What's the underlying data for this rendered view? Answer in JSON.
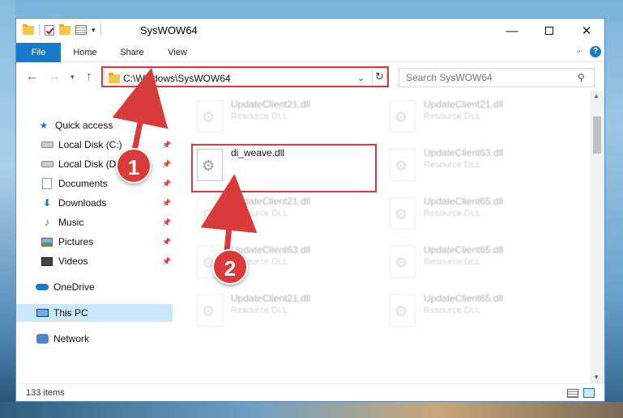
{
  "window": {
    "title": "SysWOW64",
    "controls": {
      "minimize": "—",
      "maximize": "",
      "close": "✕"
    }
  },
  "ribbon": {
    "tabs": [
      "File",
      "Home",
      "Share",
      "View"
    ],
    "collapse_glyph": "⌄",
    "help_glyph": "?"
  },
  "nav": {
    "back": "←",
    "forward": "→",
    "recent": "▾",
    "up": "↑"
  },
  "address": {
    "path": "C:\\Windows\\SysWOW64",
    "dropdown": "⌄",
    "refresh": "↻"
  },
  "search": {
    "placeholder": "Search SysWOW64",
    "icon": "⚲"
  },
  "sidebar": {
    "items": [
      {
        "label": "Quick access",
        "icon": "star-icon",
        "pinned": false
      },
      {
        "label": "Local Disk (C:)",
        "icon": "drive-icon",
        "pinned": true
      },
      {
        "label": "Local Disk (D:)",
        "icon": "drive-icon",
        "pinned": true
      },
      {
        "label": "Documents",
        "icon": "documents-icon",
        "pinned": true
      },
      {
        "label": "Downloads",
        "icon": "download-icon",
        "pinned": true
      },
      {
        "label": "Music",
        "icon": "music-icon",
        "pinned": true
      },
      {
        "label": "Pictures",
        "icon": "pictures-icon",
        "pinned": true
      },
      {
        "label": "Videos",
        "icon": "videos-icon",
        "pinned": true
      },
      {
        "label": "OneDrive",
        "icon": "cloud-icon",
        "pinned": false
      },
      {
        "label": "This PC",
        "icon": "computer-icon",
        "pinned": false,
        "selected": true
      },
      {
        "label": "Network",
        "icon": "network-icon",
        "pinned": false
      }
    ],
    "pin_glyph": "📌"
  },
  "files": {
    "col1": [
      {
        "name": "UpdateClient21.dll",
        "type": "Resource DLL"
      },
      {
        "name": "di_weave.dll",
        "type": ""
      },
      {
        "name": "UpdateClient21.dll",
        "type": "Resource DLL"
      },
      {
        "name": "UpdateClient63.dll",
        "type": "Resource DLL"
      },
      {
        "name": "UpdateClient21.dll",
        "type": "Resource DLL"
      }
    ],
    "col2": [
      {
        "name": "UpdateClient21.dll",
        "type": "Resource DLL"
      },
      {
        "name": "UpdateClient63.dll",
        "type": "Resource DLL"
      },
      {
        "name": "UpdateClient65.dll",
        "type": "Resource DLL"
      },
      {
        "name": "UpdateClient65.dll",
        "type": "Resource DLL"
      },
      {
        "name": "UpdateClient65.dll",
        "type": "Resource DLL"
      }
    ],
    "gear_glyph": "⚙"
  },
  "status": {
    "count": "133 items"
  },
  "annotations": {
    "badge1": "1",
    "badge2": "2",
    "color": "#d93a3a"
  }
}
